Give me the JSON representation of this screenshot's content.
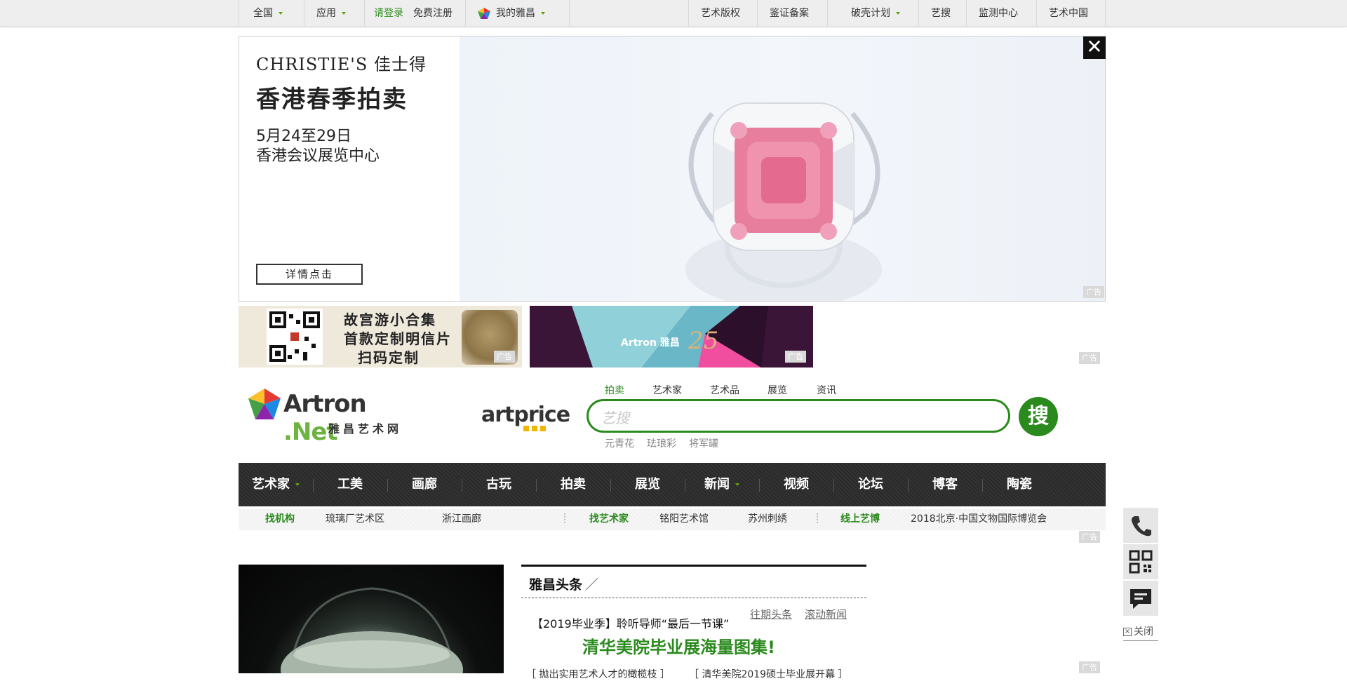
{
  "topbar": {
    "left": [
      {
        "label": "全国"
      },
      {
        "label": "应用"
      }
    ],
    "login": "请登录",
    "register": "免费注册",
    "my_artron": "我的雅昌",
    "right": [
      {
        "label": "艺术版权"
      },
      {
        "label": "鉴证备案"
      },
      {
        "label": "破壳计划"
      },
      {
        "label": "艺搜"
      },
      {
        "label": "监测中心"
      },
      {
        "label": "艺术中国"
      }
    ]
  },
  "banner": {
    "brand": "CHRISTIE'S 佳士得",
    "headline": "香港春季拍卖",
    "date": "5月24至29日",
    "venue": "香港会议展览中心",
    "cta": "详情点击",
    "ad_label": "广告",
    "close": "✕"
  },
  "small_ads": {
    "ad1_line1": "故宫游小合集",
    "ad1_line2": "首款定制明信片",
    "ad1_line3": "扫码定制",
    "ad2_brand": "Artron 雅昌",
    "ad2_sub": "25",
    "ad_label": "广告"
  },
  "logo": {
    "name": "Artron",
    "tld": ".Net",
    "cn": "雅昌艺术网",
    "partner": "artprice"
  },
  "search": {
    "tabs": [
      "拍卖",
      "艺术家",
      "艺术品",
      "展览",
      "资讯"
    ],
    "placeholder": "艺搜",
    "button": "搜",
    "hot_words": [
      "元青花",
      "珐琅彩",
      "将军罐"
    ]
  },
  "mainnav": [
    "艺术家",
    "工美",
    "画廊",
    "古玩",
    "拍卖",
    "展览",
    "新闻",
    "视频",
    "论坛",
    "博客",
    "陶瓷"
  ],
  "subnav": {
    "group1_title": "找机构",
    "group1_items": [
      "琉璃厂艺术区",
      "浙江画廊"
    ],
    "group2_title": "找艺术家",
    "group2_items": [
      "铭阳艺术馆",
      "苏州刺绣"
    ],
    "group3_title": "线上艺博",
    "group3_items": [
      "2018北京·中国文物国际博览会"
    ]
  },
  "toutiao": {
    "title": "雅昌头条",
    "past": "往期头条",
    "rolling": "滚动新闻",
    "headline1": "【2019毕业季】聆听导师“最后一节课”",
    "headline2": "清华美院毕业展海量图集!",
    "sub1": "［ 抛出实用艺术人才的橄榄枝 ］",
    "sub2": "［ 清华美院2019硕士毕业展开幕 ］"
  },
  "side_tools": {
    "close_label": "关闭"
  },
  "colors": {
    "brand_green": "#2b8a1e",
    "nav_dark": "#2e2e2e"
  }
}
